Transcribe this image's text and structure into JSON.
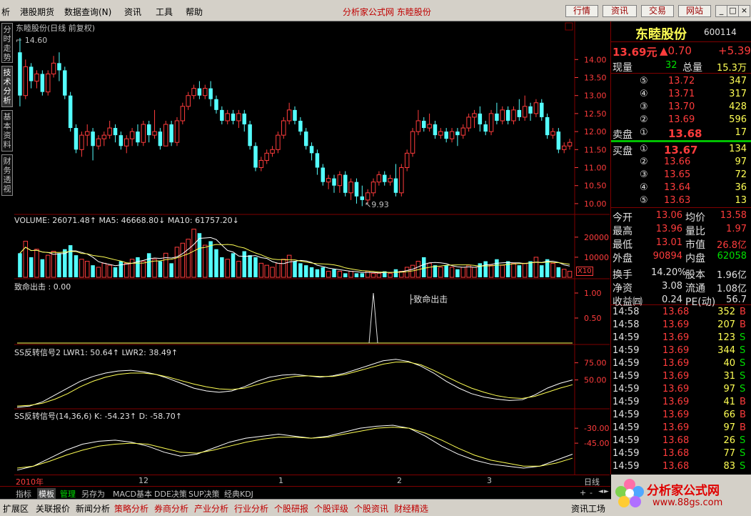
{
  "menubar": {
    "items": [
      "析",
      "港股期货",
      "数据查询(N)",
      "资讯",
      "工具",
      "帮助"
    ],
    "site_title": "分析家公式网 东睦股份",
    "buttons": [
      "行情",
      "资讯",
      "交易",
      "网站"
    ],
    "win_buttons": [
      "_",
      "□",
      "×"
    ]
  },
  "vtabs": [
    "分时走势",
    "技术分析",
    "基本资料",
    "财务透视"
  ],
  "chart": {
    "main_title": "东睦股份(日线 前复权)",
    "high_label": "14.60",
    "low_label": "9.93",
    "price_ticks": [
      "14.00",
      "13.50",
      "13.00",
      "12.50",
      "12.00",
      "11.50",
      "11.00",
      "10.50",
      "10.00"
    ],
    "volume_title": "VOLUME: 26071.48↑  MA5: 46668.80↓  MA10: 61757.20↓",
    "volume_ticks": [
      "20000",
      "10000"
    ],
    "volume_unit": "X10",
    "zhiming_title": "致命出击 : 0.00",
    "zhiming_ticks": [
      "1.00",
      "0.50"
    ],
    "zhiming_marker": "致命出击",
    "ss2_title": "SS反转信号2  LWR1: 50.64↑  LWR2: 38.49↑",
    "ss2_ticks": [
      "75.00",
      "50.00"
    ],
    "ss_title": "SS反转信号(14,36,6)  K: -54.23↑  D: -58.70↑",
    "ss_ticks": [
      "-30.00",
      "-45.00"
    ],
    "corner_box": "□"
  },
  "timeaxis": {
    "labels": [
      "2010年",
      "12",
      "1",
      "2",
      "3"
    ],
    "period": "日线"
  },
  "bottom1": [
    "指标",
    "模板",
    "管理",
    "另存为",
    "MACD基本",
    "DDE决策",
    "SUP决策",
    "经典KDJ"
  ],
  "bottom1_extra": [
    "+",
    "-",
    "◄",
    "►"
  ],
  "bottom2": [
    "扩展区",
    "关联报价",
    "新闻分析",
    "策略分析",
    "券商分析",
    "产业分析",
    "行业分析",
    "个股研报",
    "个股评级",
    "个股资讯",
    "财经精选"
  ],
  "bottom2_right": "资讯工场",
  "quote": {
    "name": "东睦股份",
    "code": "600114",
    "price": "13.69元",
    "change": "▲0.70",
    "pct": "+5.39",
    "now_vol_label": "现量",
    "now_vol": "32",
    "total_vol_label": "总量",
    "total_vol": "15.3万",
    "sell_label": "卖盘",
    "buy_label": "买盘",
    "asks": [
      {
        "n": "⑤",
        "p": "13.72",
        "v": "347"
      },
      {
        "n": "④",
        "p": "13.71",
        "v": "317"
      },
      {
        "n": "③",
        "p": "13.70",
        "v": "428"
      },
      {
        "n": "②",
        "p": "13.69",
        "v": "596"
      },
      {
        "n": "①",
        "p": "13.68",
        "v": "17"
      }
    ],
    "bids": [
      {
        "n": "①",
        "p": "13.67",
        "v": "134"
      },
      {
        "n": "②",
        "p": "13.66",
        "v": "97"
      },
      {
        "n": "③",
        "p": "13.65",
        "v": "72"
      },
      {
        "n": "④",
        "p": "13.64",
        "v": "36"
      },
      {
        "n": "⑤",
        "p": "13.63",
        "v": "13"
      }
    ],
    "stats": [
      {
        "l1": "今开",
        "v1": "13.06",
        "l2": "均价",
        "v2": "13.58"
      },
      {
        "l1": "最高",
        "v1": "13.96",
        "l2": "量比",
        "v2": "1.97"
      },
      {
        "l1": "最低",
        "v1": "13.01",
        "l2": "市值",
        "v2": "26.8亿"
      },
      {
        "l1": "外盘",
        "v1": "90894",
        "l2": "内盘",
        "v2": "62058"
      },
      {
        "l1": "换手",
        "v1": "14.20%",
        "l2": "股本",
        "v2": "1.96亿"
      },
      {
        "l1": "净资",
        "v1": "3.08",
        "l2": "流通",
        "v2": "1.08亿"
      },
      {
        "l1": "收益㈣",
        "v1": "0.24",
        "l2": "PE(动)",
        "v2": "56.7"
      }
    ],
    "ticks": [
      {
        "t": "14:58",
        "p": "13.68",
        "v": "352",
        "d": "B"
      },
      {
        "t": "14:58",
        "p": "13.69",
        "v": "207",
        "d": "B"
      },
      {
        "t": "14:59",
        "p": "13.69",
        "v": "123",
        "d": "S"
      },
      {
        "t": "14:59",
        "p": "13.69",
        "v": "344",
        "d": "S"
      },
      {
        "t": "14:59",
        "p": "13.69",
        "v": "40",
        "d": "S"
      },
      {
        "t": "14:59",
        "p": "13.69",
        "v": "31",
        "d": "S"
      },
      {
        "t": "14:59",
        "p": "13.69",
        "v": "97",
        "d": "S"
      },
      {
        "t": "14:59",
        "p": "13.69",
        "v": "41",
        "d": "B"
      },
      {
        "t": "14:59",
        "p": "13.69",
        "v": "66",
        "d": "B"
      },
      {
        "t": "14:59",
        "p": "13.69",
        "v": "97",
        "d": "B"
      },
      {
        "t": "14:59",
        "p": "13.68",
        "v": "26",
        "d": "S"
      },
      {
        "t": "14:59",
        "p": "13.68",
        "v": "77",
        "d": "S"
      },
      {
        "t": "14:59",
        "p": "13.68",
        "v": "83",
        "d": "S"
      }
    ]
  },
  "logo": {
    "text": "分析家公式网",
    "url": "www.88gs.com"
  },
  "chart_data": {
    "type": "candlestick",
    "ylim": [
      9.8,
      14.7
    ],
    "candles": [
      [
        14.2,
        13.0,
        14.6,
        12.7
      ],
      [
        13.0,
        13.8,
        14.0,
        12.9
      ],
      [
        13.8,
        13.4,
        13.9,
        13.2
      ],
      [
        13.4,
        13.6,
        13.7,
        13.2
      ],
      [
        13.6,
        13.1,
        13.7,
        13.0
      ],
      [
        13.1,
        13.6,
        13.7,
        13.0
      ],
      [
        13.6,
        13.9,
        14.1,
        13.5
      ],
      [
        13.9,
        13.7,
        14.2,
        13.4
      ],
      [
        13.7,
        13.0,
        13.8,
        12.9
      ],
      [
        13.0,
        12.1,
        13.1,
        12.0
      ],
      [
        12.1,
        11.5,
        12.2,
        11.4
      ],
      [
        11.5,
        11.9,
        12.0,
        11.3
      ],
      [
        11.9,
        12.0,
        12.2,
        11.6
      ],
      [
        12.0,
        11.6,
        12.1,
        11.2
      ],
      [
        11.6,
        11.8,
        11.9,
        11.5
      ],
      [
        11.8,
        11.9,
        12.0,
        11.6
      ],
      [
        11.9,
        12.1,
        12.3,
        11.8
      ],
      [
        12.1,
        11.9,
        12.2,
        11.7
      ],
      [
        11.9,
        11.6,
        12.0,
        11.5
      ],
      [
        11.6,
        11.8,
        11.9,
        11.4
      ],
      [
        11.8,
        12.0,
        12.1,
        11.6
      ],
      [
        12.0,
        11.7,
        12.2,
        11.6
      ],
      [
        11.7,
        12.2,
        12.3,
        11.6
      ],
      [
        12.2,
        11.9,
        12.3,
        11.7
      ],
      [
        11.9,
        12.0,
        12.6,
        11.8
      ],
      [
        12.0,
        11.6,
        12.1,
        11.5
      ],
      [
        11.6,
        12.2,
        12.3,
        11.6
      ],
      [
        12.2,
        11.7,
        12.3,
        11.6
      ],
      [
        11.7,
        12.3,
        12.4,
        11.6
      ],
      [
        12.3,
        12.7,
        12.8,
        12.2
      ],
      [
        12.7,
        13.0,
        13.1,
        12.6
      ],
      [
        13.0,
        13.2,
        13.3,
        12.9
      ],
      [
        13.2,
        13.0,
        13.4,
        12.9
      ],
      [
        13.0,
        13.2,
        13.3,
        12.9
      ],
      [
        13.2,
        12.9,
        13.4,
        12.7
      ],
      [
        12.9,
        12.6,
        13.0,
        12.5
      ],
      [
        12.6,
        12.3,
        12.7,
        12.2
      ],
      [
        12.3,
        12.5,
        12.6,
        12.2
      ],
      [
        12.5,
        12.3,
        12.6,
        12.2
      ],
      [
        12.3,
        12.5,
        12.6,
        12.1
      ],
      [
        12.5,
        12.2,
        12.6,
        12.0
      ],
      [
        12.2,
        11.6,
        12.3,
        11.5
      ],
      [
        11.6,
        11.0,
        11.7,
        10.9
      ],
      [
        11.0,
        11.2,
        11.3,
        10.9
      ],
      [
        11.2,
        11.4,
        11.5,
        11.1
      ],
      [
        11.4,
        11.5,
        11.6,
        11.3
      ],
      [
        11.5,
        11.9,
        12.0,
        11.4
      ],
      [
        11.9,
        12.3,
        12.4,
        11.8
      ],
      [
        12.3,
        12.6,
        12.8,
        12.2
      ],
      [
        12.6,
        12.3,
        12.7,
        12.2
      ],
      [
        12.3,
        12.0,
        12.4,
        11.9
      ],
      [
        12.0,
        11.6,
        12.1,
        11.5
      ],
      [
        11.6,
        11.4,
        11.7,
        11.2
      ],
      [
        11.4,
        11.0,
        11.5,
        10.8
      ],
      [
        11.0,
        10.6,
        11.1,
        10.5
      ],
      [
        10.6,
        10.7,
        10.8,
        10.4
      ],
      [
        10.7,
        10.5,
        10.8,
        10.3
      ],
      [
        10.5,
        10.8,
        10.9,
        10.3
      ],
      [
        10.8,
        10.3,
        10.9,
        10.2
      ],
      [
        10.3,
        10.6,
        10.7,
        10.1
      ],
      [
        10.6,
        10.2,
        10.7,
        10.0
      ],
      [
        10.2,
        10.1,
        10.5,
        9.93
      ],
      [
        10.1,
        10.3,
        10.4,
        10.0
      ],
      [
        10.3,
        10.6,
        10.7,
        10.2
      ],
      [
        10.6,
        10.8,
        10.9,
        10.5
      ],
      [
        10.8,
        10.6,
        10.9,
        10.5
      ],
      [
        10.6,
        10.7,
        10.8,
        10.5
      ],
      [
        10.7,
        10.3,
        11.1,
        10.2
      ],
      [
        10.3,
        11.0,
        11.1,
        10.2
      ],
      [
        11.0,
        11.4,
        11.5,
        10.9
      ],
      [
        11.4,
        12.0,
        12.1,
        11.3
      ],
      [
        12.0,
        12.3,
        12.6,
        11.9
      ],
      [
        12.3,
        12.1,
        12.4,
        12.0
      ],
      [
        12.1,
        12.2,
        12.5,
        12.0
      ],
      [
        12.2,
        11.9,
        12.3,
        11.8
      ],
      [
        11.9,
        12.0,
        12.1,
        11.8
      ],
      [
        12.0,
        11.8,
        12.1,
        11.7
      ],
      [
        11.8,
        12.0,
        12.1,
        11.7
      ],
      [
        12.0,
        11.9,
        12.1,
        11.6
      ],
      [
        11.9,
        12.1,
        12.2,
        11.8
      ],
      [
        12.1,
        12.4,
        12.5,
        12.0
      ],
      [
        12.4,
        12.5,
        12.6,
        12.1
      ],
      [
        12.5,
        12.2,
        12.7,
        12.0
      ],
      [
        12.2,
        12.0,
        12.3,
        11.9
      ],
      [
        12.0,
        12.5,
        12.6,
        11.9
      ],
      [
        12.5,
        12.3,
        12.8,
        12.2
      ],
      [
        12.3,
        12.6,
        12.7,
        12.2
      ],
      [
        12.6,
        12.3,
        12.7,
        12.2
      ],
      [
        12.3,
        12.6,
        12.7,
        12.2
      ],
      [
        12.6,
        12.4,
        12.9,
        12.3
      ],
      [
        12.4,
        12.7,
        13.0,
        12.3
      ],
      [
        12.7,
        12.5,
        12.8,
        12.3
      ],
      [
        12.5,
        12.8,
        12.9,
        12.4
      ],
      [
        12.8,
        12.4,
        12.9,
        12.3
      ],
      [
        12.4,
        11.9,
        12.5,
        11.8
      ],
      [
        11.9,
        12.0,
        12.1,
        11.8
      ],
      [
        12.0,
        11.5,
        12.1,
        11.4
      ],
      [
        11.5,
        11.6,
        11.7,
        11.4
      ],
      [
        11.6,
        11.7,
        11.8,
        11.5
      ]
    ],
    "volume": [
      12,
      18,
      10,
      14,
      9,
      11,
      13,
      12,
      14,
      16,
      11,
      9,
      8,
      6,
      5,
      7,
      6,
      5,
      8,
      7,
      9,
      10,
      8,
      12,
      9,
      8,
      12,
      7,
      15,
      17,
      19,
      24,
      22,
      16,
      18,
      14,
      10,
      9,
      12,
      8,
      13,
      11,
      10,
      7,
      6,
      5,
      7,
      9,
      11,
      8,
      7,
      6,
      5,
      4,
      5,
      3,
      4,
      3,
      2,
      3,
      2,
      2,
      3,
      2,
      2,
      3,
      2,
      4,
      3,
      5,
      6,
      8,
      10,
      7,
      6,
      5,
      6,
      5,
      4,
      5,
      6,
      5,
      7,
      8,
      6,
      9,
      6,
      8,
      7,
      6,
      7,
      8,
      10,
      6,
      9,
      7,
      5,
      4,
      3
    ],
    "zhiming_signal_index": 63,
    "ss2_lwr1": [
      10,
      12,
      18,
      28,
      38,
      48,
      55,
      60,
      63,
      64,
      62,
      58,
      52,
      45,
      38,
      34,
      32,
      34,
      40,
      48,
      54,
      57,
      58,
      56,
      54,
      56,
      60,
      66,
      72,
      78,
      80,
      77,
      70,
      60,
      48,
      38,
      30,
      25,
      22,
      20,
      21,
      28,
      38,
      45,
      50
    ],
    "ss2_lwr2": [
      12,
      13,
      16,
      22,
      30,
      40,
      48,
      54,
      58,
      60,
      60,
      58,
      54,
      49,
      44,
      40,
      37,
      36,
      38,
      43,
      48,
      52,
      55,
      56,
      55,
      55,
      58,
      63,
      68,
      73,
      76,
      76,
      72,
      64,
      55,
      46,
      38,
      32,
      27,
      24,
      23,
      26,
      32,
      38,
      43
    ],
    "ss_k": [
      -72,
      -68,
      -60,
      -52,
      -46,
      -43,
      -42,
      -44,
      -48,
      -54,
      -58,
      -56,
      -50,
      -44,
      -40,
      -38,
      -36,
      -38,
      -40,
      -38,
      -34,
      -30,
      -28,
      -27,
      -30,
      -38,
      -48,
      -56,
      -62,
      -66,
      -68,
      -70,
      -68,
      -62,
      -56
    ],
    "ss_d": [
      -70,
      -68,
      -63,
      -57,
      -52,
      -48,
      -46,
      -45,
      -46,
      -50,
      -54,
      -55,
      -52,
      -48,
      -44,
      -41,
      -39,
      -39,
      -40,
      -39,
      -36,
      -33,
      -30,
      -29,
      -30,
      -35,
      -42,
      -50,
      -57,
      -62,
      -65,
      -68,
      -68,
      -65,
      -60
    ]
  }
}
